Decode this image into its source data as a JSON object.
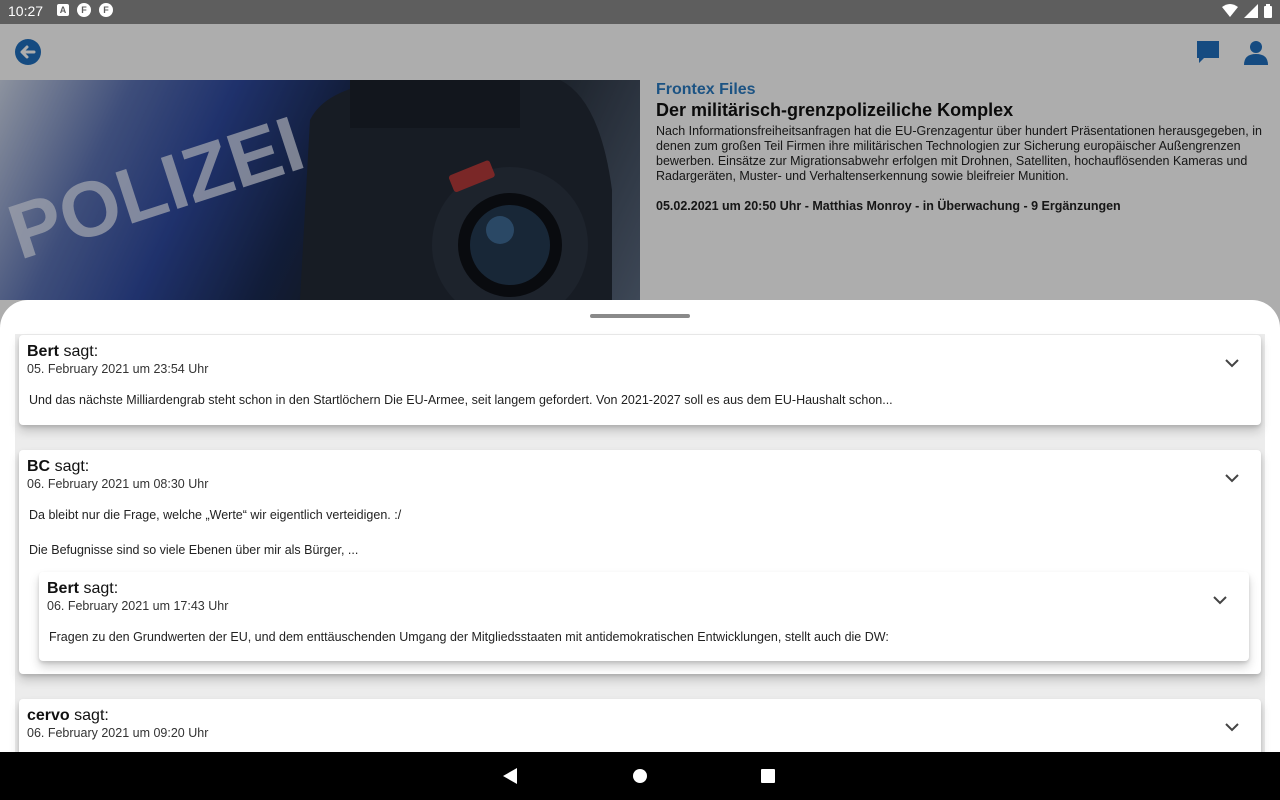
{
  "status_bar": {
    "time": "10:27",
    "notification_icons": [
      "a-icon",
      "f-icon",
      "f-icon"
    ],
    "system_icons": [
      "wifi-icon",
      "signal-icon",
      "battery-icon"
    ]
  },
  "app_bar": {
    "back_icon": "arrow-back-icon",
    "comments_icon": "chat-bubble-icon",
    "account_icon": "person-icon",
    "accent_color": "#1f6fbf"
  },
  "article": {
    "kicker": "Frontex Files",
    "headline": "Der militärisch-grenzpolizeiliche Komplex",
    "teaser": "Nach Informationsfreiheitsanfragen hat die EU-Grenzagentur über hundert Präsentationen herausgegeben, in denen zum großen Teil Firmen ihre militärischen Technologien zur Sicherung europäischer Außengrenzen bewerben. Einsätze zur Migrationsabwehr erfolgen mit Drohnen, Satelliten, hochauflösenden Kameras und Radargeräten, Muster- und Verhaltenserkennung sowie bleifreier Munition.",
    "meta": "05.02.2021 um 20:50 Uhr - Matthias Monroy - in Überwachung - 9 Ergänzungen",
    "image_text": "POLIZEI"
  },
  "comments": {
    "says_label": "sagt:",
    "items": [
      {
        "author": "Bert",
        "date": "05. February 2021 um 23:54 Uhr",
        "body": [
          "Und das nächste Milliardengrab steht schon in den Startlöchern Die EU-Armee, seit langem gefordert. Von 2021-2027 soll es aus dem EU-Haushalt schon..."
        ]
      },
      {
        "author": "BC",
        "date": "06. February 2021 um 08:30 Uhr",
        "body": [
          "Da bleibt nur die Frage, welche „Werte“ wir eigentlich verteidigen. :/",
          "Die Befugnisse sind so viele Ebenen über mir als Bürger, ..."
        ],
        "replies": [
          {
            "author": "Bert",
            "date": "06. February 2021 um 17:43 Uhr",
            "body": [
              "Fragen zu den Grundwerten der EU, und dem enttäuschenden Umgang der Mitgliedsstaaten mit antidemokratischen Entwicklungen, stellt auch die DW:"
            ]
          }
        ]
      },
      {
        "author": "cervo",
        "date": "06. February 2021 um 09:20 Uhr",
        "body": []
      }
    ]
  },
  "nav_bar": {
    "icons": [
      "nav-back-icon",
      "nav-home-icon",
      "nav-recents-icon"
    ]
  }
}
